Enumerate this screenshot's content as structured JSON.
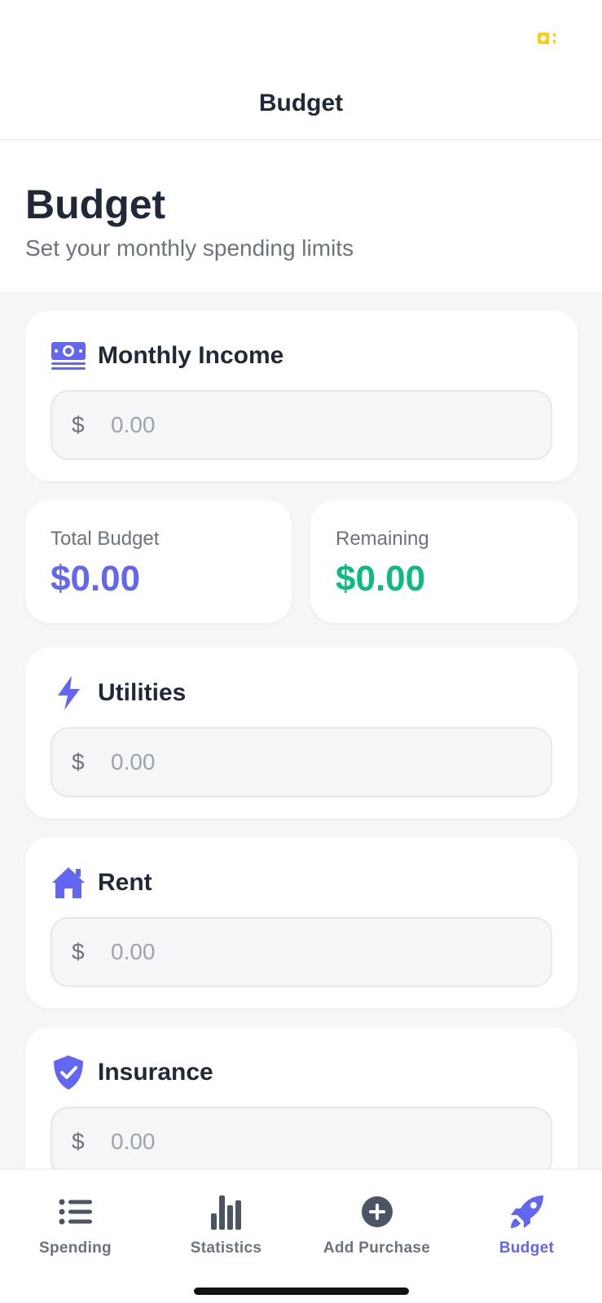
{
  "nav": {
    "title": "Budget"
  },
  "header": {
    "title": "Budget",
    "subtitle": "Set your monthly spending limits"
  },
  "income": {
    "title": "Monthly Income",
    "currency": "$",
    "placeholder": "0.00",
    "icon": "money-icon"
  },
  "summary": {
    "total_label": "Total Budget",
    "total_value": "$0.00",
    "total_color": "#6366f1",
    "remaining_label": "Remaining",
    "remaining_value": "$0.00",
    "remaining_color": "#10b981"
  },
  "categories": [
    {
      "title": "Utilities",
      "currency": "$",
      "placeholder": "0.00",
      "icon": "bolt-icon"
    },
    {
      "title": "Rent",
      "currency": "$",
      "placeholder": "0.00",
      "icon": "house-icon"
    },
    {
      "title": "Insurance",
      "currency": "$",
      "placeholder": "0.00",
      "icon": "shield-check-icon"
    }
  ],
  "tabs": [
    {
      "label": "Spending",
      "icon": "list-icon",
      "active": false
    },
    {
      "label": "Statistics",
      "icon": "bar-chart-icon",
      "active": false
    },
    {
      "label": "Add Purchase",
      "icon": "plus-circle-icon",
      "active": false
    },
    {
      "label": "Budget",
      "icon": "rocket-icon",
      "active": true
    }
  ],
  "colors": {
    "accent": "#6366f1",
    "positive": "#10b981",
    "battery": "#facc15"
  }
}
